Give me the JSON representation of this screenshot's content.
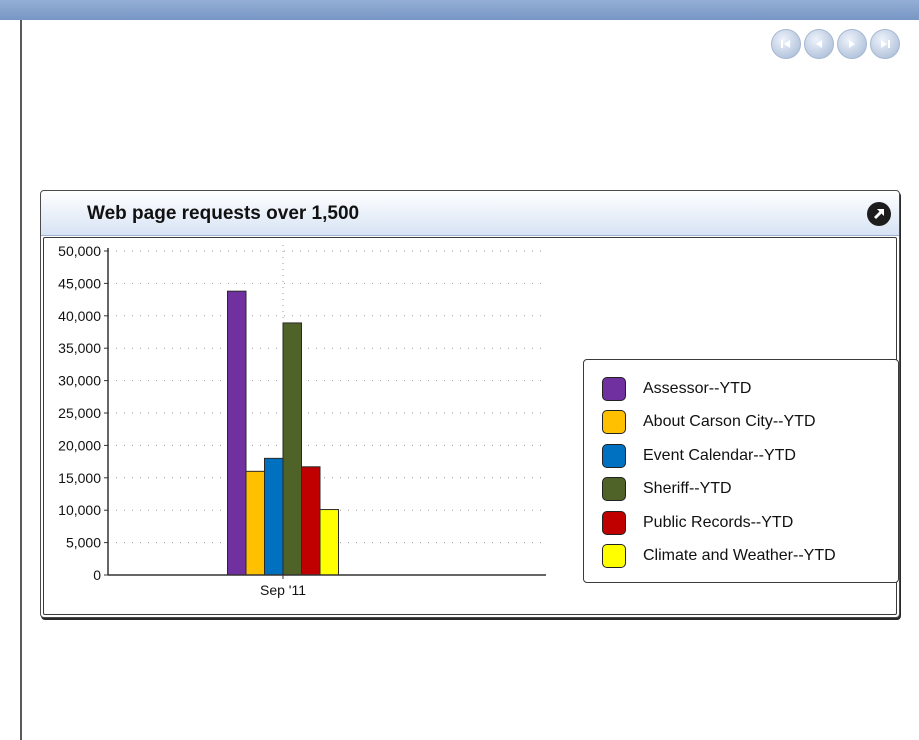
{
  "panel": {
    "title": "Web page requests over 1,500"
  },
  "nav_buttons": [
    {
      "icon": "first-page-icon"
    },
    {
      "icon": "previous-page-icon"
    },
    {
      "icon": "next-page-icon"
    },
    {
      "icon": "last-page-icon"
    }
  ],
  "colors": {
    "header_top": "#ffffff",
    "header_bottom": "#d7e3f4",
    "top_bar": "#7f9cc9"
  },
  "chart_data": {
    "type": "bar",
    "categories": [
      "Sep '11"
    ],
    "ylim": [
      0,
      50000
    ],
    "yticks": [
      0,
      5000,
      10000,
      15000,
      20000,
      25000,
      30000,
      35000,
      40000,
      45000,
      50000
    ],
    "ytick_labels": [
      "0",
      "5,000",
      "10,000",
      "15,000",
      "20,000",
      "25,000",
      "30,000",
      "35,000",
      "40,000",
      "45,000",
      "50,000"
    ],
    "grid": true,
    "legend_position": "right",
    "series": [
      {
        "name": "Assessor--YTD",
        "color": "#7030a0",
        "values": [
          43800
        ]
      },
      {
        "name": "About Carson City--YTD",
        "color": "#ffc000",
        "values": [
          16000
        ]
      },
      {
        "name": "Event Calendar--YTD",
        "color": "#0070c0",
        "values": [
          18000
        ]
      },
      {
        "name": "Sheriff--YTD",
        "color": "#4f6228",
        "values": [
          38900
        ]
      },
      {
        "name": "Public Records--YTD",
        "color": "#c00000",
        "values": [
          16700
        ]
      },
      {
        "name": "Climate and Weather--YTD",
        "color": "#ffff00",
        "values": [
          10100
        ]
      }
    ]
  }
}
